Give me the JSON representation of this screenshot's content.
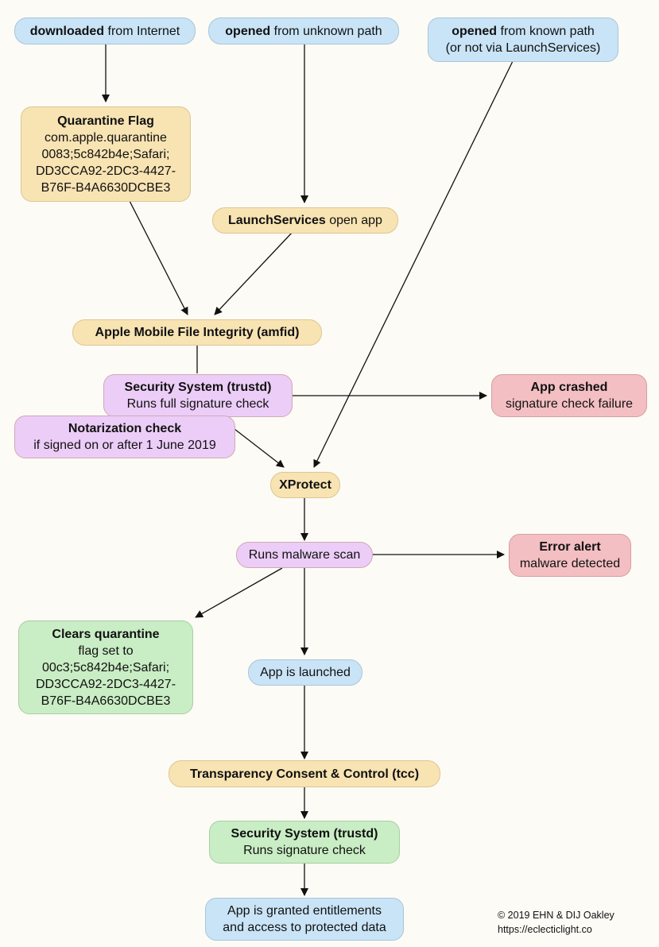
{
  "nodes": {
    "downloaded": {
      "bold": "downloaded",
      "text": " from Internet"
    },
    "opened_unknown": {
      "bold": "opened",
      "text": " from unknown path"
    },
    "opened_known": {
      "bold": "opened",
      "text": " from known path",
      "line2": "(or not via LaunchServices)"
    },
    "quarantine_flag": {
      "title": "Quarantine Flag",
      "lines": [
        "com.apple.quarantine",
        "0083;5c842b4e;Safari;",
        "DD3CCA92-2DC3-4427-",
        "B76F-B4A6630DCBE3"
      ]
    },
    "launchservices": {
      "bold": "LaunchServices",
      "text": " open app"
    },
    "amfid": {
      "title": "Apple Mobile File Integrity (amfid)"
    },
    "trustd_full": {
      "title": "Security System (trustd)",
      "line2": "Runs full signature check"
    },
    "notarization": {
      "title": "Notarization check",
      "line2": "if signed on or after 1 June 2019"
    },
    "app_crashed": {
      "title": "App crashed",
      "line2": "signature check failure"
    },
    "xprotect": {
      "title": "XProtect"
    },
    "malware_scan": {
      "text": "Runs malware scan"
    },
    "error_alert": {
      "title": "Error alert",
      "line2": "malware detected"
    },
    "clears_quarantine": {
      "title": "Clears quarantine",
      "lines": [
        "flag set to",
        "00c3;5c842b4e;Safari;",
        "DD3CCA92-2DC3-4427-",
        "B76F-B4A6630DCBE3"
      ]
    },
    "app_launched": {
      "text": "App is launched"
    },
    "tcc": {
      "title": "Transparency Consent & Control (tcc)"
    },
    "trustd_sig": {
      "title": "Security System (trustd)",
      "line2": "Runs signature check"
    },
    "entitlements": {
      "line1": "App is granted entitlements",
      "line2": "and access to protected data"
    }
  },
  "credit": {
    "copyright": "© 2019 EHN & DIJ Oakley",
    "url": "https://eclecticlight.co"
  },
  "colors": {
    "blue": "#c9e4f6",
    "yellow": "#f8e3b3",
    "purple": "#eccdf7",
    "red": "#f3bfc3",
    "green": "#c9edc4",
    "background": "#fdfbf5"
  }
}
